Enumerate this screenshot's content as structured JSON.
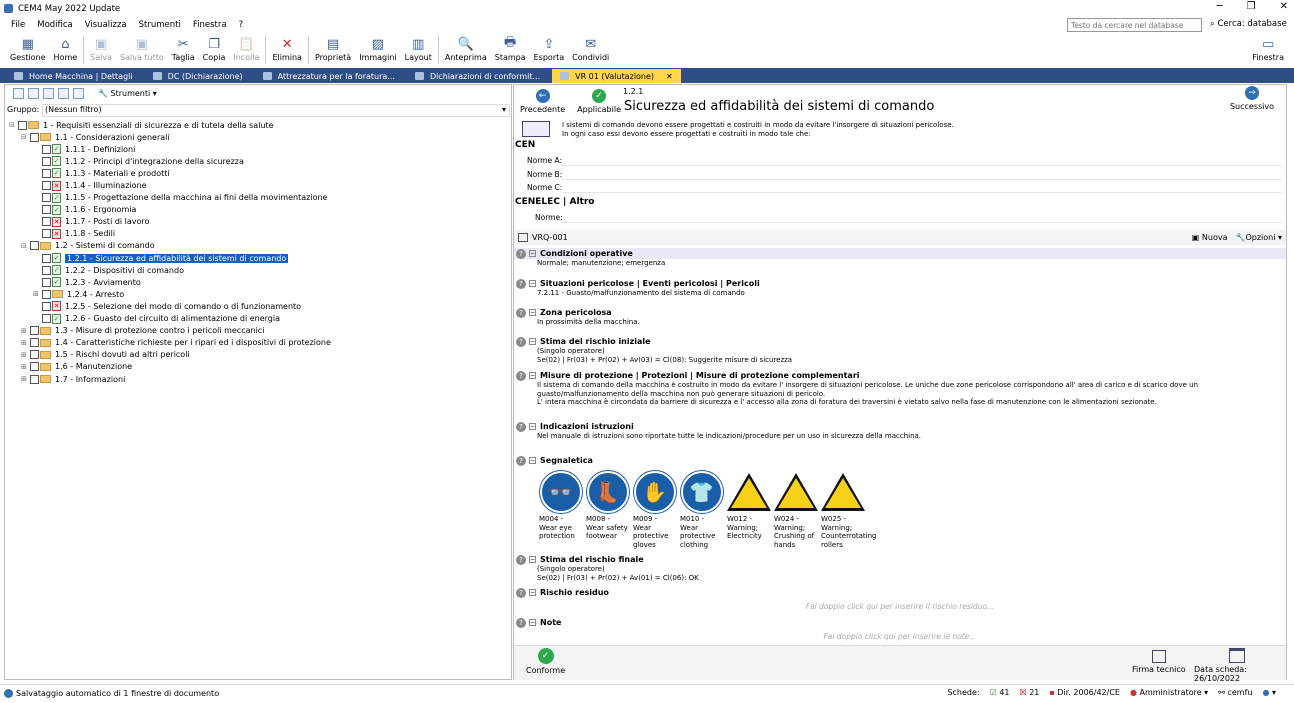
{
  "app": {
    "title": "CEM4 May 2022 Update"
  },
  "menu": [
    "File",
    "Modifica",
    "Visualizza",
    "Strumenti",
    "Finestra",
    "?"
  ],
  "search": {
    "placeholder": "Testo da cercare nel database",
    "label": "Cerca: database"
  },
  "toolbar": [
    {
      "label": "Gestione",
      "icon": "gestione-icon",
      "glyph": "▦",
      "enabled": true
    },
    {
      "label": "Home",
      "icon": "home-icon",
      "glyph": "⌂",
      "enabled": true
    },
    {
      "label": "Salva",
      "icon": "save-icon",
      "glyph": "▣",
      "enabled": false
    },
    {
      "label": "Salva tutto",
      "icon": "save-all-icon",
      "glyph": "▣",
      "enabled": false
    },
    {
      "label": "Taglia",
      "icon": "cut-icon",
      "glyph": "✂",
      "enabled": true
    },
    {
      "label": "Copia",
      "icon": "copy-icon",
      "glyph": "❐",
      "enabled": true
    },
    {
      "label": "Incolla",
      "icon": "paste-icon",
      "glyph": "📋",
      "enabled": false
    },
    {
      "label": "Elimina",
      "icon": "delete-icon",
      "glyph": "✕",
      "enabled": true
    },
    {
      "label": "Proprietà",
      "icon": "properties-icon",
      "glyph": "▤",
      "enabled": true
    },
    {
      "label": "Immagini",
      "icon": "images-icon",
      "glyph": "▨",
      "enabled": true
    },
    {
      "label": "Layout",
      "icon": "layout-icon",
      "glyph": "▥",
      "enabled": true
    },
    {
      "label": "Anteprima",
      "icon": "preview-icon",
      "glyph": "🔍",
      "enabled": true
    },
    {
      "label": "Stampa",
      "icon": "print-icon",
      "glyph": "🖶",
      "enabled": true
    },
    {
      "label": "Esporta",
      "icon": "export-icon",
      "glyph": "⇪",
      "enabled": true
    },
    {
      "label": "Condividi",
      "icon": "share-icon",
      "glyph": "✉",
      "enabled": true
    }
  ],
  "finestra": "Finestra",
  "tabs": [
    {
      "label": "Home Macchina | Dettagli",
      "active": false
    },
    {
      "label": "DC (Dichiarazione)",
      "active": false
    },
    {
      "label": "Attrezzatura per la foratura...",
      "active": false
    },
    {
      "label": "Dichiarazioni di conformit...",
      "active": false
    },
    {
      "label": "VR 01 (Valutazione)",
      "active": true
    }
  ],
  "left": {
    "strumenti": "Strumenti",
    "gruppo_label": "Gruppo:",
    "gruppo_value": "(Nessun filtro)",
    "tree": [
      {
        "level": 0,
        "type": "folder",
        "exp": "⊟",
        "label": "1 - Requisiti essenziali di sicurezza e di tutela della salute"
      },
      {
        "level": 1,
        "type": "folder",
        "exp": "⊟",
        "label": "1.1 - Considerazioni generali"
      },
      {
        "level": 2,
        "type": "ok",
        "label": "1.1.1 - Definizioni"
      },
      {
        "level": 2,
        "type": "ok",
        "label": "1.1.2 - Principi d'integrazione della sicurezza"
      },
      {
        "level": 2,
        "type": "ok",
        "label": "1.1.3 - Materiali e prodotti"
      },
      {
        "level": 2,
        "type": "no",
        "label": "1.1.4 - Illuminazione"
      },
      {
        "level": 2,
        "type": "ok",
        "label": "1.1.5 - Progettazione della macchina ai fini della movimentazione"
      },
      {
        "level": 2,
        "type": "ok",
        "label": "1.1.6 - Ergonomia"
      },
      {
        "level": 2,
        "type": "no",
        "label": "1.1.7 - Posti di lavoro"
      },
      {
        "level": 2,
        "type": "no",
        "label": "1.1.8 - Sedili"
      },
      {
        "level": 1,
        "type": "folder",
        "exp": "⊟",
        "label": "1.2 - Sistemi di comando"
      },
      {
        "level": 2,
        "type": "ok",
        "label": "1.2.1 - Sicurezza ed affidabilità dei sistemi di comando",
        "selected": true
      },
      {
        "level": 2,
        "type": "ok",
        "label": "1.2.2 - Dispositivi di comando"
      },
      {
        "level": 2,
        "type": "ok",
        "label": "1.2.3 - Avviamento"
      },
      {
        "level": 2,
        "type": "folder",
        "exp": "⊞",
        "label": "1.2.4 - Arresto"
      },
      {
        "level": 2,
        "type": "no",
        "label": "1.2.5 - Selezione del modo di comando o di funzionamento"
      },
      {
        "level": 2,
        "type": "ok",
        "label": "1.2.6 - Guasto del circuito di alimentazione di energia"
      },
      {
        "level": 1,
        "type": "folder",
        "exp": "⊞",
        "label": "1.3 - Misure di protezione contro i pericoli meccanici"
      },
      {
        "level": 1,
        "type": "folder",
        "exp": "⊞",
        "label": "1.4 - Caratteristiche richieste per i ripari ed i dispositivi di protezione"
      },
      {
        "level": 1,
        "type": "folder",
        "exp": "⊞",
        "label": "1.5 - Rischi dovuti ad altri pericoli"
      },
      {
        "level": 1,
        "type": "folder",
        "exp": "⊞",
        "label": "1.6 - Manutenzione"
      },
      {
        "level": 1,
        "type": "folder",
        "exp": "⊞",
        "label": "1.7 - Informazioni"
      }
    ]
  },
  "right": {
    "prev": "Precedente",
    "applicable": "Applicabile",
    "next": "Successivo",
    "number": "1.2.1",
    "title": "Sicurezza ed affidabilità dei sistemi di comando",
    "desc1": "I sistemi di comando devono essere progettati e costruiti in modo da evitare l'insorgere di situazioni pericolose.",
    "desc2": "In ogni caso essi devono essere progettati e costruiti in modo tale che:",
    "cen": "CEN",
    "norme_a": "Norme A:",
    "norme_b": "Norme B:",
    "norme_c": "Norme C:",
    "cenelec": "CENELEC | Altro",
    "norme": "Norme:",
    "vrq": "VRQ-001",
    "nuova": "Nuova",
    "opzioni": "Opzioni",
    "sections": {
      "condizioni": {
        "title": "Condizioni operative",
        "body": "Normale; manutenzione; emergenza"
      },
      "situazioni": {
        "title": "Situazioni pericolose | Eventi pericolosi | Pericoli",
        "body": "7.2.11 - Guasto/malfunzionamento del sistema di comando"
      },
      "zona": {
        "title": "Zona pericolosa",
        "body": "In prossimità della macchina."
      },
      "stima_iniziale": {
        "title": "Stima del rischio iniziale",
        "body1": "(Singolo operatore)",
        "body2": "Se(02) | Fr(03) + Pr(02) + Av(03) = Cl(08): Suggerite misure di sicurezza"
      },
      "misure": {
        "title": "Misure di protezione | Protezioni | Misure di protezione complementari",
        "body1": "Il sistema di comando della macchina è costruito in modo da evitare l' insorgere di situazioni pericolose. Le uniche due zone pericolose corrispondono all' area di carico e di scarico dove un guasto/malfunzionamento della macchina non può generare situazioni di pericolo.",
        "body2": "L' intera macchina è circondata da barriere di sicurezza e l' accesso alla zona di foratura dei traversini è vietato salvo nella fase di manutenzione con le alimentazioni sezionate."
      },
      "istruzioni": {
        "title": "Indicazioni istruzioni",
        "body": "Nel manuale di istruzioni sono riportate tutte le indicazioni/procedure per un uso in sicurezza della macchina."
      },
      "segnaletica": {
        "title": "Segnaletica"
      },
      "stima_finale": {
        "title": "Stima del rischio finale",
        "body1": "(Singolo operatore)",
        "body2": "Se(02) | Fr(03) + Pr(02) + Av(01) = Cl(06): OK"
      },
      "residuo": {
        "title": "Rischio residuo",
        "placeholder": "Fai doppio click qui per inserire il rischio residuo..."
      },
      "note": {
        "title": "Note",
        "placeholder": "Fai doppio click qui per inserire le note..."
      }
    },
    "signs": [
      {
        "kind": "mand",
        "icon": "eye-protection-icon",
        "glyph": "👓",
        "caption": "M004 - Wear eye protection"
      },
      {
        "kind": "mand",
        "icon": "safety-footwear-icon",
        "glyph": "👢",
        "caption": "M008 - Wear safety footwear"
      },
      {
        "kind": "mand",
        "icon": "protective-gloves-icon",
        "glyph": "✋",
        "caption": "M009 - Wear protective gloves"
      },
      {
        "kind": "mand",
        "icon": "protective-clothing-icon",
        "glyph": "👕",
        "caption": "M010 - Wear protective clothing"
      },
      {
        "kind": "warn",
        "icon": "electricity-warning-icon",
        "caption": "W012 - Warning; Electricity"
      },
      {
        "kind": "warn",
        "icon": "crushing-hands-warning-icon",
        "caption": "W024 - Warning; Crushing of hands"
      },
      {
        "kind": "warn",
        "icon": "counterrotating-rollers-warning-icon",
        "caption": "W025 - Warning; Counterrotating rollers"
      }
    ],
    "conforme": "Conforme",
    "firma": "Firma tecnico",
    "data_scheda": "Data scheda: 26/10/2022"
  },
  "status": {
    "left": "Salvataggio automatico di 1 finestre di documento",
    "schede": "Schede:",
    "count_ok": "41",
    "count_no": "21",
    "dir": "Dir. 2006/42/CE",
    "user": "Amministratore",
    "db": "cemfu"
  }
}
